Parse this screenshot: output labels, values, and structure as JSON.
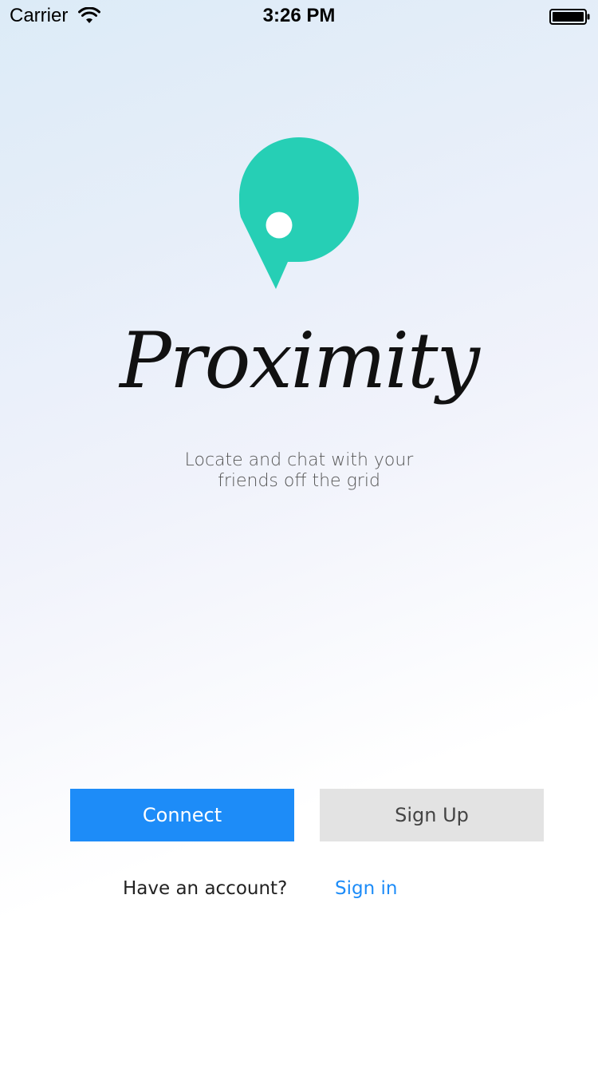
{
  "status_bar": {
    "carrier": "Carrier",
    "time": "3:26 PM",
    "icons": [
      "wifi-icon",
      "battery-icon"
    ]
  },
  "app": {
    "logo_icon": "map-pin-chat-bubble-icon",
    "brand_color": "#26cfb5",
    "name": "Proximity",
    "tagline_line1": "Locate and chat with your",
    "tagline_line2": "friends off the grid"
  },
  "actions": {
    "connect_label": "Connect",
    "signup_label": "Sign Up",
    "connect_color": "#1d8cf8",
    "signup_color": "#e3e3e3"
  },
  "account": {
    "prompt": "Have an account?",
    "sign_in_label": "Sign in",
    "link_color": "#1d8cf8"
  }
}
